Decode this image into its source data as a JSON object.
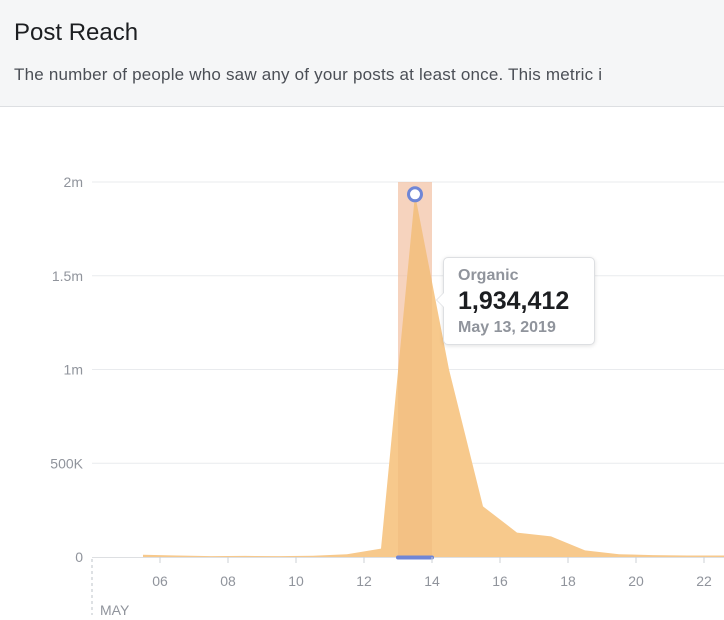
{
  "header": {
    "title": "Post Reach",
    "subtitle": "The number of people who saw any of your posts at least once. This metric i"
  },
  "tooltip": {
    "series": "Organic",
    "value": "1,934,412",
    "date": "May 13, 2019"
  },
  "colors": {
    "area_fill": "#f7c98c",
    "highlight_band": "#f5c9b7",
    "marker": "#6f86d6",
    "grid": "#e9ebee",
    "tick_text": "#90949c"
  },
  "chart_data": {
    "type": "area",
    "title": "Post Reach",
    "xlabel": "",
    "ylabel": "",
    "x_month_label": "MAY",
    "x": [
      5,
      6,
      7,
      8,
      9,
      10,
      11,
      12,
      13,
      14,
      15,
      16,
      17,
      18,
      19,
      20,
      21,
      22,
      23
    ],
    "x_tick_labels": [
      "06",
      "08",
      "10",
      "12",
      "14",
      "16",
      "18",
      "20",
      "22"
    ],
    "y_ticks": [
      0,
      500000,
      1000000,
      1500000,
      2000000
    ],
    "y_tick_labels": [
      "0",
      "500K",
      "1m",
      "1.5m",
      "2m"
    ],
    "ylim": [
      0,
      2000000
    ],
    "grid": true,
    "series": [
      {
        "name": "Organic",
        "values": [
          12000,
          8000,
          5000,
          6000,
          5000,
          7000,
          15000,
          45000,
          1934412,
          1000000,
          270000,
          130000,
          110000,
          35000,
          15000,
          10000,
          8000,
          8000,
          8000
        ]
      }
    ],
    "highlighted_x": 13
  }
}
